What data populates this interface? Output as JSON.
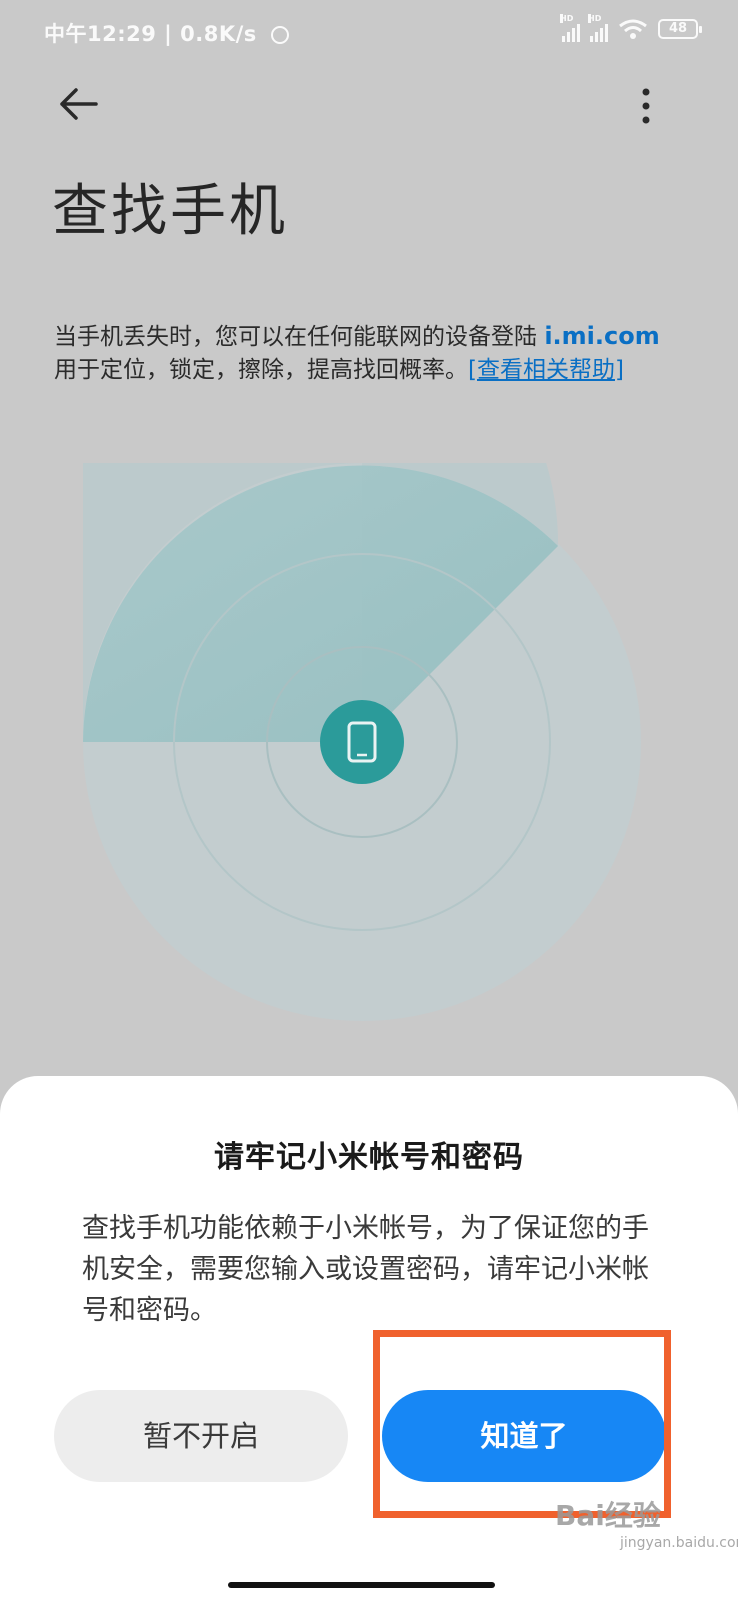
{
  "status_bar": {
    "time": "中午12:29",
    "speed": "0.8K/s",
    "network_type": "HD",
    "battery": "48"
  },
  "header": {
    "back_icon": "arrow-left-icon",
    "more_icon": "more-vertical-icon",
    "title": "查找手机"
  },
  "description": {
    "line1_text": "当手机丢失时，您可以在任何能联网的设备登陆 ",
    "url": "i.mi.com",
    "line2_text": "用于定位，锁定，擦除，提高找回概率。",
    "help_link": "[查看相关帮助]"
  },
  "radar": {
    "center_icon": "phone-icon",
    "colors": {
      "ring": "#c3cdcf",
      "sweep": "#9fc3c5",
      "center": "#2b9b9a"
    }
  },
  "dialog": {
    "title": "请牢记小米帐号和密码",
    "body": "查找手机功能依赖于小米帐号，为了保证您的手机安全，需要您输入或设置密码，请牢记小米帐号和密码。",
    "cancel_label": "暂不开启",
    "ok_label": "知道了"
  },
  "colors": {
    "accent": "#1787f5",
    "highlight": "#f0612d",
    "link": "#0a6fc4"
  },
  "watermark": {
    "brand": "Bai",
    "brand2": "经验",
    "site": "jingyan.baidu.com"
  }
}
